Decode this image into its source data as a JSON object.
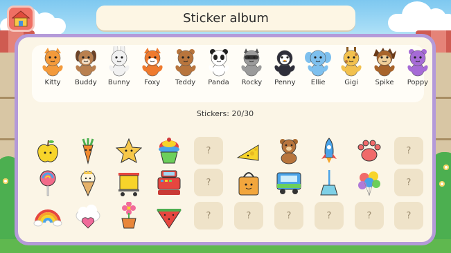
{
  "header": {
    "title": "Sticker album",
    "home_icon": "house-icon"
  },
  "characters": [
    {
      "name": "Kitty",
      "animal": "cat",
      "color": "#f39a3b"
    },
    {
      "name": "Buddy",
      "animal": "dog",
      "color": "#b9804f"
    },
    {
      "name": "Bunny",
      "animal": "rabbit",
      "color": "#f1f1f1"
    },
    {
      "name": "Foxy",
      "animal": "fox",
      "color": "#ef7a2e"
    },
    {
      "name": "Teddy",
      "animal": "bear",
      "color": "#b8753d"
    },
    {
      "name": "Panda",
      "animal": "panda",
      "color": "#ffffff"
    },
    {
      "name": "Rocky",
      "animal": "raccoon",
      "color": "#9b9b9b"
    },
    {
      "name": "Penny",
      "animal": "penguin",
      "color": "#2f2f3a"
    },
    {
      "name": "Ellie",
      "animal": "elephant",
      "color": "#7ec0ee"
    },
    {
      "name": "Gigi",
      "animal": "giraffe",
      "color": "#f2c14e"
    },
    {
      "name": "Spike",
      "animal": "hedgehog",
      "color": "#a8642b"
    },
    {
      "name": "Poppy",
      "animal": "hippo",
      "color": "#a66bd6"
    }
  ],
  "progress": {
    "label": "Stickers: 20/30",
    "collected": 20,
    "total": 30
  },
  "grid": [
    [
      "apple-sticker",
      "carrot-sticker",
      "star-sticker",
      "cupcake-sticker",
      "empty",
      "cheese-sticker",
      "teddy-bear-sticker",
      "rocket-sticker",
      "paw-sticker",
      "empty"
    ],
    [
      "lollipop-sticker",
      "ice-cream-sticker",
      "shopping-cart-sticker",
      "cash-register-sticker",
      "empty",
      "shopping-bag-sticker",
      "truck-sticker",
      "broom-sticker",
      "balloons-sticker",
      "empty"
    ],
    [
      "rainbow-sticker",
      "cloud-heart-sticker",
      "flower-pot-sticker",
      "watermelon-sticker",
      "empty",
      "empty",
      "empty",
      "empty",
      "empty",
      "empty"
    ]
  ],
  "empty_slot_label": "?"
}
